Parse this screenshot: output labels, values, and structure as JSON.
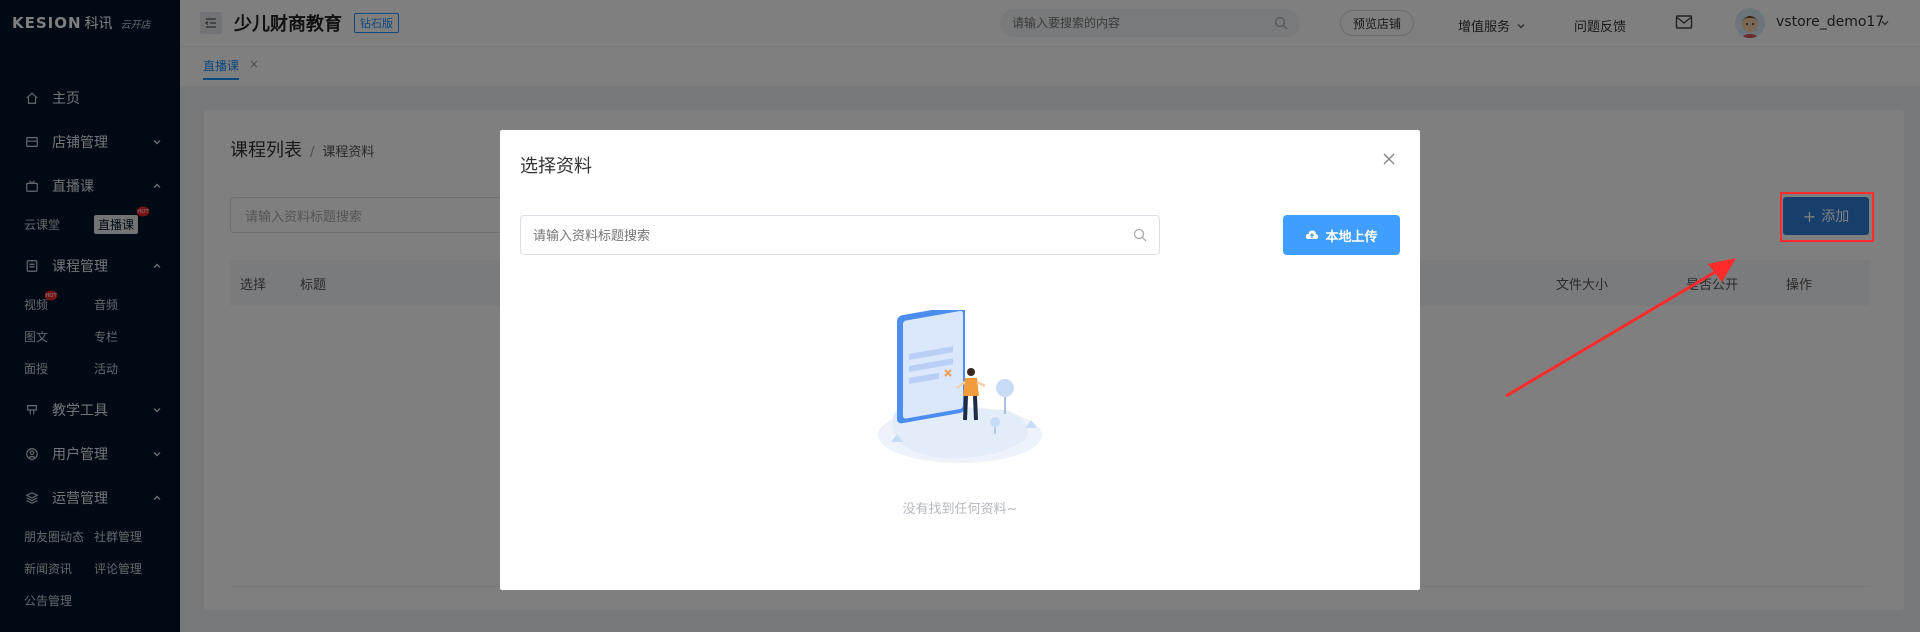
{
  "sidebar": {
    "logo": {
      "brand": "KESION",
      "cn": "科讯",
      "script": "云开店"
    },
    "menu": [
      {
        "label": "主页",
        "icon": "home-icon",
        "has_chevron": false
      },
      {
        "label": "店铺管理",
        "icon": "store-icon",
        "has_chevron": true,
        "expanded": false
      },
      {
        "label": "直播课",
        "icon": "live-icon",
        "has_chevron": true,
        "expanded": true,
        "items": [
          {
            "label": "云课堂"
          },
          {
            "label": "直播课",
            "active": true,
            "hot": "HOT"
          }
        ]
      },
      {
        "label": "课程管理",
        "icon": "course-icon",
        "has_chevron": true,
        "expanded": true,
        "items": [
          {
            "label": "视频",
            "hot": "HOT"
          },
          {
            "label": "音频"
          },
          {
            "label": "图文"
          },
          {
            "label": "专栏"
          },
          {
            "label": "面授"
          },
          {
            "label": "活动"
          }
        ]
      },
      {
        "label": "教学工具",
        "icon": "tools-icon",
        "has_chevron": true,
        "expanded": false
      },
      {
        "label": "用户管理",
        "icon": "user-icon",
        "has_chevron": true,
        "expanded": false
      },
      {
        "label": "运营管理",
        "icon": "layers-icon",
        "has_chevron": true,
        "expanded": true,
        "items": [
          {
            "label": "朋友圈动态"
          },
          {
            "label": "社群管理"
          },
          {
            "label": "新闻资讯"
          },
          {
            "label": "评论管理"
          },
          {
            "label": "公告管理"
          }
        ]
      }
    ]
  },
  "topbar": {
    "school_name": "少儿财商教育",
    "edition": "钻石版",
    "search_placeholder": "请输入要搜索的内容",
    "preview_store": "预览店铺",
    "value_services": "增值服务",
    "feedback": "问题反馈",
    "username": "vstore_demo17"
  },
  "tabs": [
    {
      "label": "直播课",
      "close": "×"
    }
  ],
  "content": {
    "breadcrumb": {
      "main": "课程列表",
      "sep": "/",
      "sub": "课程资料"
    },
    "filter_placeholder": "请输入资料标题搜索",
    "add_button": "添加",
    "table_headers": {
      "select": "选择",
      "title": "标题",
      "file_size": "文件大小",
      "public": "是否公开",
      "actions": "操作"
    }
  },
  "modal": {
    "title": "选择资料",
    "search_placeholder": "请输入资料标题搜索",
    "upload_button": "本地上传",
    "empty_text": "没有找到任何资料~"
  },
  "colors": {
    "sidebar_bg": "#001529",
    "primary": "#409eff",
    "add_button": "#2d7fd6",
    "annotation_red": "#ff2a2a",
    "hot_badge": "#f5222d"
  }
}
